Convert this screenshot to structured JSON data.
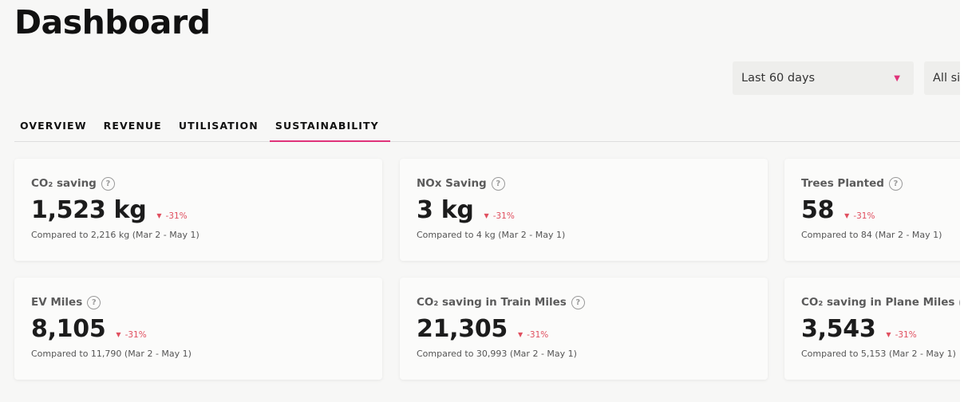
{
  "page": {
    "title": "Dashboard"
  },
  "filters": {
    "period": "Last 60 days",
    "site": "All sites"
  },
  "tabs": [
    "OVERVIEW",
    "REVENUE",
    "UTILISATION",
    "SUSTAINABILITY"
  ],
  "active_tab": "SUSTAINABILITY",
  "cards": [
    {
      "label": "CO₂ saving",
      "value": "1,523 kg",
      "delta": "-31%",
      "compare": "Compared to 2,216 kg (Mar 2 - May 1)"
    },
    {
      "label": "NOx Saving",
      "value": "3 kg",
      "delta": "-31%",
      "compare": "Compared to 4 kg (Mar 2 - May 1)"
    },
    {
      "label": "Trees Planted",
      "value": "58",
      "delta": "-31%",
      "compare": "Compared to 84 (Mar 2 - May 1)"
    },
    {
      "label": "EV Miles",
      "value": "8,105",
      "delta": "-31%",
      "compare": "Compared to 11,790 (Mar 2 - May 1)"
    },
    {
      "label": "CO₂ saving in Train Miles",
      "value": "21,305",
      "delta": "-31%",
      "compare": "Compared to 30,993 (Mar 2 - May 1)"
    },
    {
      "label": "CO₂ saving in Plane Miles",
      "value": "3,543",
      "delta": "-31%",
      "compare": "Compared to 5,153 (Mar 2 - May 1)"
    }
  ],
  "icons": {
    "help": "question-circle-icon",
    "dropdown": "caret-down-icon",
    "delta_down": "triangle-down-icon"
  },
  "colors": {
    "accent": "#e0337a",
    "negative": "#e04f5f"
  }
}
